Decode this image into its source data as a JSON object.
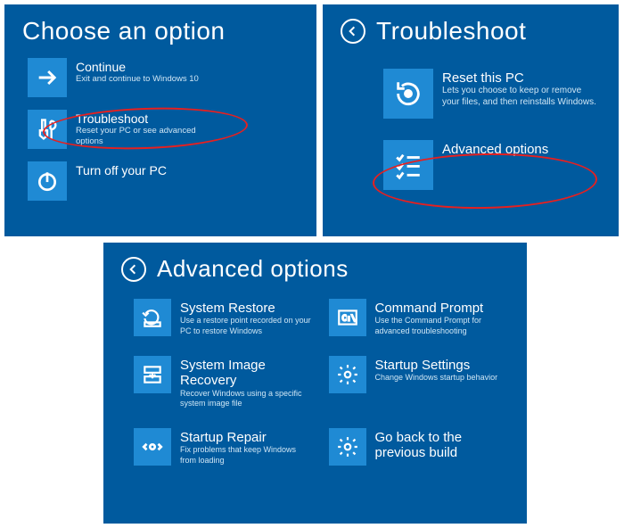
{
  "choose": {
    "title": "Choose an option",
    "items": [
      {
        "label": "Continue",
        "desc": "Exit and continue to Windows 10",
        "icon": "arrow-right-icon"
      },
      {
        "label": "Troubleshoot",
        "desc": "Reset your PC or see advanced options",
        "icon": "wrench-icon"
      },
      {
        "label": "Turn off your PC",
        "desc": "",
        "icon": "power-icon"
      }
    ]
  },
  "troubleshoot": {
    "title": "Troubleshoot",
    "items": [
      {
        "label": "Reset this PC",
        "desc": "Lets you choose to keep or remove your files, and then reinstalls Windows.",
        "icon": "reset-icon"
      },
      {
        "label": "Advanced options",
        "desc": "",
        "icon": "checklist-icon"
      }
    ]
  },
  "advanced": {
    "title": "Advanced options",
    "items": [
      {
        "label": "System Restore",
        "desc": "Use a restore point recorded on your PC to restore Windows",
        "icon": "restore-icon"
      },
      {
        "label": "Command Prompt",
        "desc": "Use the Command Prompt for advanced troubleshooting",
        "icon": "cmd-icon"
      },
      {
        "label": "System Image Recovery",
        "desc": "Recover Windows using a specific system image file",
        "icon": "image-recovery-icon"
      },
      {
        "label": "Startup Settings",
        "desc": "Change Windows startup behavior",
        "icon": "gear-icon"
      },
      {
        "label": "Startup Repair",
        "desc": "Fix problems that keep Windows from loading",
        "icon": "repair-icon"
      },
      {
        "label": "Go back to the previous build",
        "desc": "",
        "icon": "gear-icon"
      }
    ]
  }
}
